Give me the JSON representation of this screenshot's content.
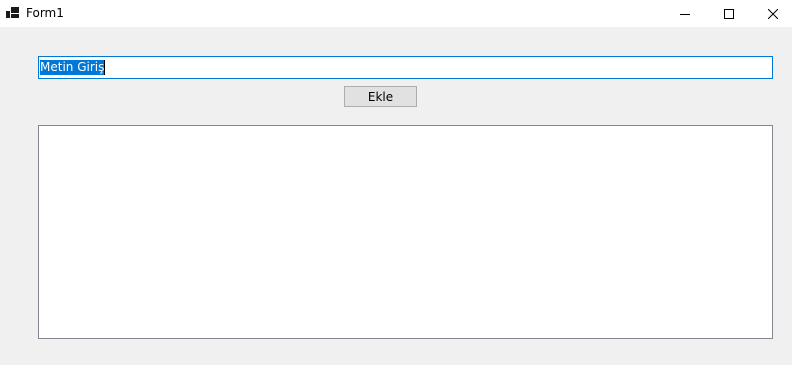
{
  "window": {
    "title": "Form1",
    "app_icon": "winforms-app-icon",
    "controls": {
      "minimize_icon": "minimize-icon",
      "maximize_icon": "maximize-icon",
      "close_icon": "close-icon"
    }
  },
  "form": {
    "text_input": {
      "value": "Metin Giriş",
      "selected": true
    },
    "add_button_label": "Ekle",
    "list_items": []
  },
  "colors": {
    "accent": "#0078d7",
    "form_background": "#f0f0f0",
    "button_background": "#e1e1e1"
  }
}
